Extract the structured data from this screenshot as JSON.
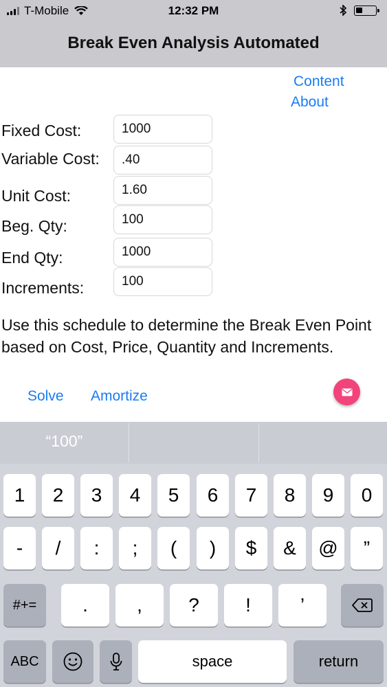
{
  "status_bar": {
    "carrier": "T-Mobile",
    "time": "12:32 PM",
    "signal_icon": "signal-bars-icon",
    "wifi_icon": "wifi-icon",
    "bluetooth_icon": "bluetooth-icon",
    "battery_icon": "battery-icon",
    "battery_level": 0.35
  },
  "nav": {
    "title": "Break Even Analysis Automated"
  },
  "links": {
    "content": "Content",
    "about": "About"
  },
  "fields": [
    {
      "label": "Fixed Cost:",
      "value": "1000"
    },
    {
      "label": "Variable Cost:",
      "value": ".40"
    },
    {
      "label": "Unit Cost:",
      "value": "1.60"
    },
    {
      "label": "Beg. Qty:",
      "value": "100"
    },
    {
      "label": "End Qty:",
      "value": "1000"
    },
    {
      "label": "Increments:",
      "value": "100"
    }
  ],
  "description": "Use this schedule to determine the Break Even Point based on Cost, Price, Quantity and Increments.",
  "actions": {
    "solve": "Solve",
    "amortize": "Amortize",
    "fab_icon": "envelope-icon",
    "fab_color": "#f2447a"
  },
  "keyboard": {
    "suggestions": [
      "“100”",
      "",
      ""
    ],
    "row1": [
      "1",
      "2",
      "3",
      "4",
      "5",
      "6",
      "7",
      "8",
      "9",
      "0"
    ],
    "row2": [
      "-",
      "/",
      ":",
      ";",
      "(",
      ")",
      "$",
      "&",
      "@",
      "”"
    ],
    "row3_toggle": "#+=",
    "row3": [
      ".",
      ",",
      "?",
      "!",
      "’"
    ],
    "backspace_icon": "backspace-icon",
    "abc": "ABC",
    "emoji_icon": "emoji-icon",
    "mic_icon": "microphone-icon",
    "space": "space",
    "return": "return"
  },
  "colors": {
    "accent": "#1a7cf0",
    "bar": "#c9c9ce",
    "keyboard_bg": "#d1d4da"
  }
}
